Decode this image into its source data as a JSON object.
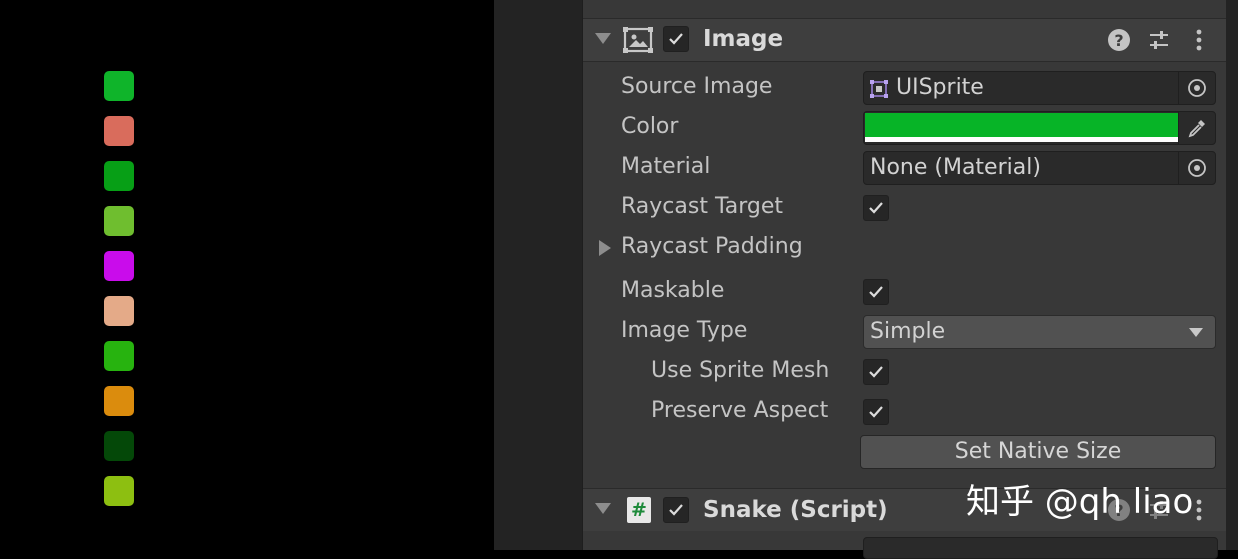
{
  "game_view": {
    "swatches": [
      {
        "name": "swatch-1",
        "color": "#0fb42a"
      },
      {
        "name": "swatch-2",
        "color": "#d96c5c"
      },
      {
        "name": "swatch-3",
        "color": "#079f16"
      },
      {
        "name": "swatch-4",
        "color": "#6fbe2f"
      },
      {
        "name": "swatch-5",
        "color": "#c90ceb"
      },
      {
        "name": "swatch-6",
        "color": "#e4aa88"
      },
      {
        "name": "swatch-7",
        "color": "#27b30f"
      },
      {
        "name": "swatch-8",
        "color": "#db8c0d"
      },
      {
        "name": "swatch-9",
        "color": "#044808"
      },
      {
        "name": "swatch-10",
        "color": "#8dbf11"
      }
    ]
  },
  "image_component": {
    "title": "Image",
    "enabled": true,
    "icon": "image-component-icon",
    "header_icons": [
      "help-icon",
      "preset-sliders-icon",
      "kebab-menu-icon"
    ],
    "fields": {
      "source_image": {
        "label": "Source Image",
        "value": "UISprite",
        "icon": "sprite-icon"
      },
      "color": {
        "label": "Color",
        "value": "#07b427"
      },
      "material": {
        "label": "Material",
        "value": "None (Material)"
      },
      "raycast_target": {
        "label": "Raycast Target",
        "checked": true
      },
      "raycast_padding": {
        "label": "Raycast Padding"
      },
      "maskable": {
        "label": "Maskable",
        "checked": true
      },
      "image_type": {
        "label": "Image Type",
        "value": "Simple"
      },
      "use_sprite_mesh": {
        "label": "Use Sprite Mesh",
        "checked": true
      },
      "preserve_aspect": {
        "label": "Preserve Aspect",
        "checked": true
      }
    },
    "set_native_size_label": "Set Native Size"
  },
  "snake_component": {
    "title": "Snake (Script)",
    "enabled": true,
    "icon": "csharp-script-icon",
    "icon_glyph": "#"
  },
  "watermark": "知乎 @qh liao"
}
